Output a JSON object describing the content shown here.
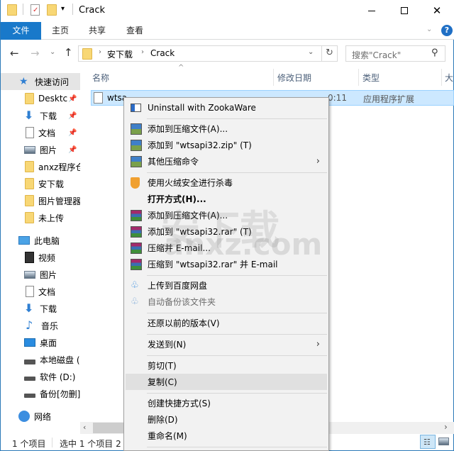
{
  "window": {
    "title": "Crack",
    "minimize_icon": "minimize-icon",
    "maximize_icon": "maximize-icon",
    "close_icon": "close-icon"
  },
  "ribbon": {
    "tabs": [
      {
        "label": "文件"
      },
      {
        "label": "主页"
      },
      {
        "label": "共享"
      },
      {
        "label": "查看"
      }
    ]
  },
  "address": {
    "breadcrumb": [
      "安下载",
      "Crack"
    ],
    "search_placeholder": "搜索\"Crack\""
  },
  "sidebar": {
    "quick_access": "快速访问",
    "quick_items": [
      {
        "label": "Desktc",
        "pinned": true
      },
      {
        "label": "下载",
        "pinned": true
      },
      {
        "label": "文档",
        "pinned": true
      },
      {
        "label": "图片",
        "pinned": true
      },
      {
        "label": "anxz程序仓",
        "pinned": false
      },
      {
        "label": "安下载",
        "pinned": false
      },
      {
        "label": "图片管理器",
        "pinned": false
      },
      {
        "label": "未上传",
        "pinned": false
      }
    ],
    "this_pc": "此电脑",
    "pc_items": [
      {
        "label": "视频"
      },
      {
        "label": "图片"
      },
      {
        "label": "文档"
      },
      {
        "label": "下载"
      },
      {
        "label": "音乐"
      },
      {
        "label": "桌面"
      },
      {
        "label": "本地磁盘 ("
      },
      {
        "label": "软件 (D:)"
      },
      {
        "label": "备份[勿删]"
      }
    ],
    "network": "网络"
  },
  "columns": {
    "name": "名称",
    "date": "修改日期",
    "type": "类型",
    "size": "大"
  },
  "file": {
    "name": "wtsa",
    "date": "0:11",
    "type": "应用程序扩展"
  },
  "status": {
    "count": "1 个项目",
    "selected": "选中 1 个项目 2"
  },
  "context_menu": {
    "items": [
      {
        "label": "Uninstall with ZookaWare",
        "icon": "zookaware-icon"
      },
      {
        "label": "添加到压缩文件(A)...",
        "icon": "zip-icon"
      },
      {
        "label": "添加到 \"wtsapi32.zip\" (T)",
        "icon": "zip-icon"
      },
      {
        "label": "其他压缩命令",
        "icon": "zip-icon",
        "submenu": true
      },
      {
        "label": "使用火绒安全进行杀毒",
        "icon": "huorong-shield-icon"
      },
      {
        "label": "打开方式(H)...",
        "bold": true
      },
      {
        "label": "添加到压缩文件(A)...",
        "icon": "winrar-icon"
      },
      {
        "label": "添加到 \"wtsapi32.rar\" (T)",
        "icon": "winrar-icon"
      },
      {
        "label": "压缩并 E-mail...",
        "icon": "winrar-icon"
      },
      {
        "label": "压缩到 \"wtsapi32.rar\" 并 E-mail",
        "icon": "winrar-icon"
      },
      {
        "label": "上传到百度网盘",
        "icon": "baidu-cloud-icon"
      },
      {
        "label": "自动备份该文件夹",
        "icon": "baidu-cloud-icon",
        "disabled": true
      },
      {
        "label": "还原以前的版本(V)"
      },
      {
        "label": "发送到(N)",
        "submenu": true
      },
      {
        "label": "剪切(T)"
      },
      {
        "label": "复制(C)",
        "hover": true
      },
      {
        "label": "创建快捷方式(S)"
      },
      {
        "label": "删除(D)"
      },
      {
        "label": "重命名(M)"
      }
    ]
  },
  "watermark": {
    "line1": "安下载",
    "line2": "anxz.com"
  }
}
